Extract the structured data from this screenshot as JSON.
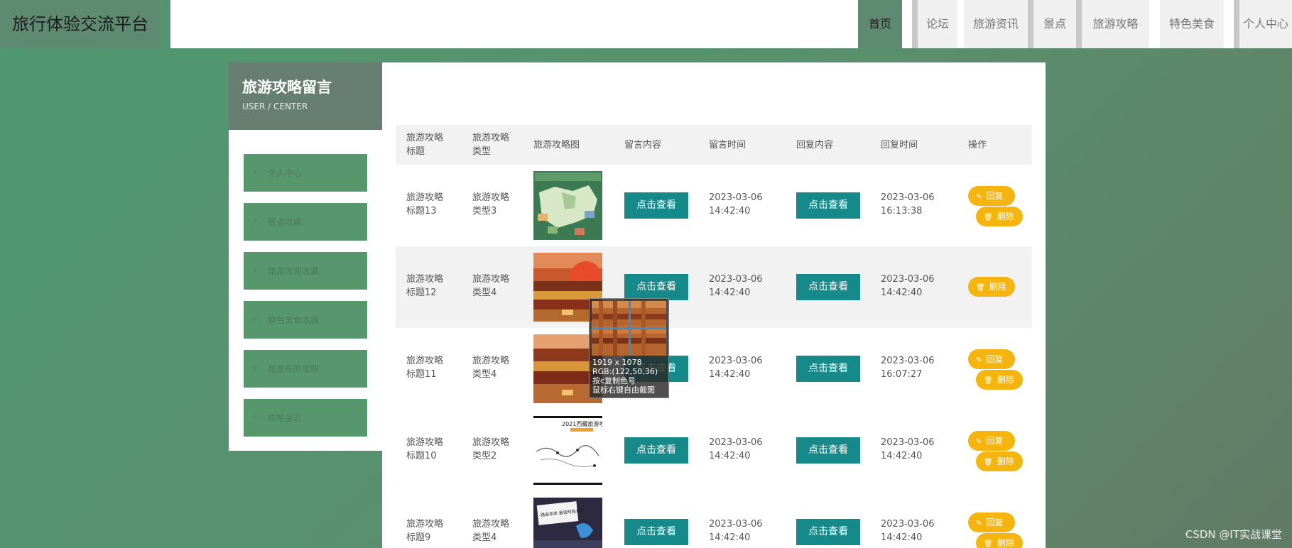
{
  "brand": {
    "title": "旅行体验交流平台"
  },
  "nav": {
    "items": [
      {
        "label": "首页"
      },
      {
        "label": "论坛"
      },
      {
        "label": "旅游资讯"
      },
      {
        "label": "景点"
      },
      {
        "label": "旅游攻略"
      },
      {
        "label": "特色美食"
      },
      {
        "label": "个人中心"
      }
    ]
  },
  "sidebar": {
    "title": "旅游攻略留言",
    "subtitle": "USER / CENTER",
    "items": [
      {
        "label": "个人中心"
      },
      {
        "label": "景点收藏"
      },
      {
        "label": "旅游攻略收藏"
      },
      {
        "label": "特色美食收藏"
      },
      {
        "label": "我发布的攻略"
      },
      {
        "label": "攻略留言"
      }
    ]
  },
  "table": {
    "headers": {
      "title": "旅游攻略标题",
      "type": "旅游攻略类型",
      "image": "旅游攻略图",
      "content": "留言内容",
      "time": "留言时间",
      "reply": "回复内容",
      "reply_time": "回复时间",
      "actions": "操作"
    },
    "view_label": "点击查看",
    "reply_label": "回复",
    "delete_label": "删除",
    "rows": [
      {
        "title_a": "旅游攻略",
        "title_b": "标题13",
        "type_a": "旅游攻略",
        "type_b": "类型3",
        "date": "2023-03-06",
        "time": "14:42:40",
        "rdate": "2023-03-06",
        "rtime": "16:13:38"
      },
      {
        "title_a": "旅游攻略",
        "title_b": "标题12",
        "type_a": "旅游攻略",
        "type_b": "类型4",
        "date": "2023-03-06",
        "time": "14:42:40",
        "rdate": "2023-03-06",
        "rtime": "14:42:40"
      },
      {
        "title_a": "旅游攻略",
        "title_b": "标题11",
        "type_a": "旅游攻略",
        "type_b": "类型4",
        "date": "2023-03-06",
        "time": "14:42:40",
        "rdate": "2023-03-06",
        "rtime": "16:07:27"
      },
      {
        "title_a": "旅游攻略",
        "title_b": "标题10",
        "type_a": "旅游攻略",
        "type_b": "类型2",
        "date": "2023-03-06",
        "time": "14:42:40",
        "rdate": "2023-03-06",
        "rtime": "14:42:40"
      },
      {
        "title_a": "旅游攻略",
        "title_b": "标题9",
        "type_a": "旅游攻略",
        "type_b": "类型4",
        "date": "2023-03-06",
        "time": "14:42:40",
        "rdate": "2023-03-06",
        "rtime": "14:42:40"
      }
    ]
  },
  "thumbnails": {
    "row4_title": "2021西藏旅游攻略",
    "row5_text": "路由本岸 最佳时段攻略"
  },
  "magnifier": {
    "size": "1919 x 1078",
    "rgb": "RGB:(122,50,36)",
    "hint1": "按c复制色号",
    "hint2": "鼠标右键自由截图"
  },
  "watermark": "CSDN @IT实战课堂"
}
